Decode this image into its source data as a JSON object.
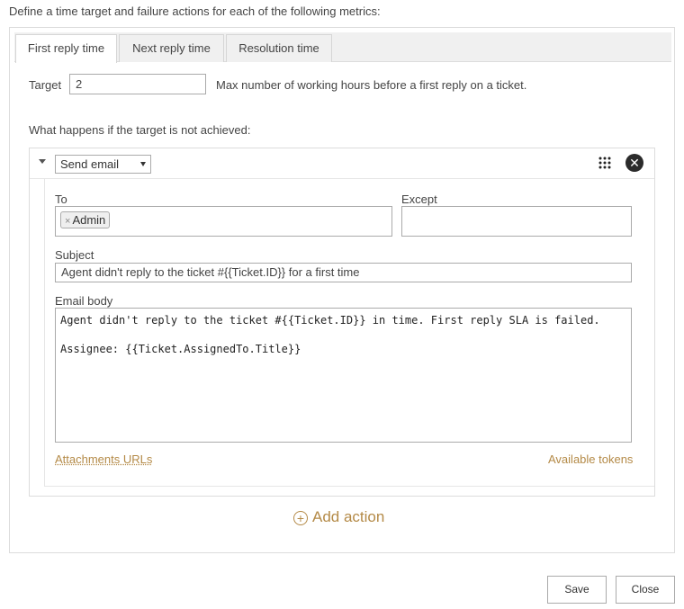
{
  "intro": "Define a time target and failure actions for each of the following metrics:",
  "tabs": [
    {
      "label": "First reply time",
      "active": true
    },
    {
      "label": "Next reply time",
      "active": false
    },
    {
      "label": "Resolution time",
      "active": false
    }
  ],
  "target": {
    "label": "Target",
    "value": "2",
    "hint": "Max number of working hours before a first reply on a ticket."
  },
  "failure_heading": "What happens if the target is not achieved:",
  "action": {
    "type": "Send email",
    "to_label": "To",
    "to_recipients": [
      "Admin"
    ],
    "except_label": "Except",
    "except_value": "",
    "subject_label": "Subject",
    "subject_value": "Agent didn't reply to the ticket #{{Ticket.ID}} for a first time",
    "body_label": "Email body",
    "body_value": "Agent didn't reply to the ticket #{{Ticket.ID}} in time. First reply SLA is failed.\n\nAssignee: {{Ticket.AssignedTo.Title}}",
    "attachments_link": "Attachments URLs",
    "tokens_link": "Available tokens"
  },
  "add_action_label": "Add action",
  "buttons": {
    "save": "Save",
    "close": "Close"
  },
  "colors": {
    "accent": "#b48a47",
    "border": "#aaaaaa"
  },
  "icons": {
    "drag": "grid-icon",
    "remove": "close-circle-icon",
    "add": "plus-circle-icon",
    "collapse": "caret-down-icon",
    "dropdown": "chevron-down-icon"
  }
}
